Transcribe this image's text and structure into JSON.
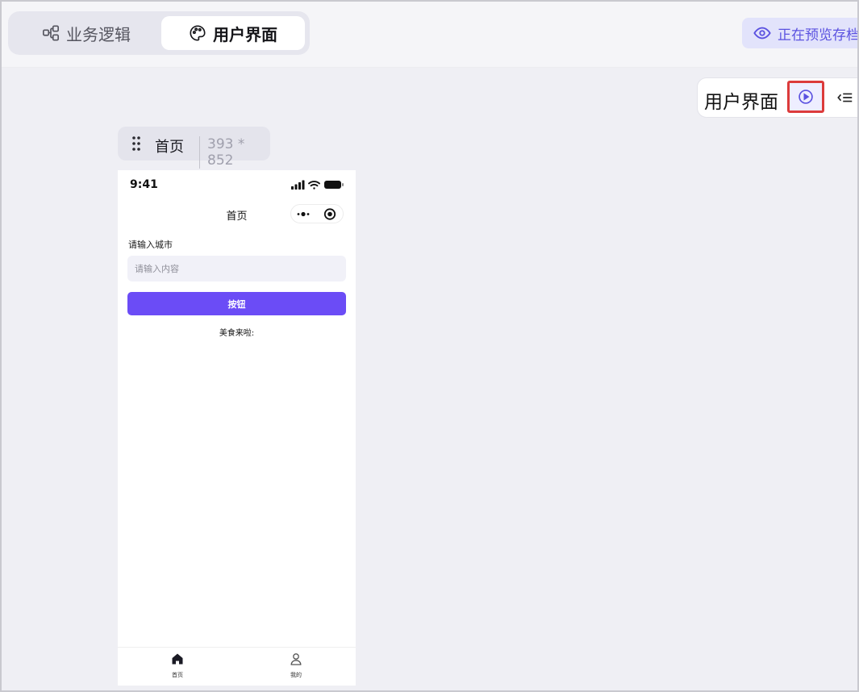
{
  "topbar": {
    "tabs": [
      {
        "label": "业务逻辑",
        "icon": "flow-nodes-icon",
        "active": false
      },
      {
        "label": "用户界面",
        "icon": "palette-icon",
        "active": true
      }
    ],
    "preview": {
      "label": "正在预览存档",
      "icon": "eye-icon"
    }
  },
  "panel": {
    "title": "用户界面",
    "run_icon": "play-circle-icon",
    "collapse_icon": "collapse-list-icon"
  },
  "page_chip": {
    "name": "首页",
    "size": "393 * 852"
  },
  "phone": {
    "status": {
      "time": "9:41"
    },
    "nav_title": "首页",
    "field_label": "请输入城市",
    "input_placeholder": "请输入内容",
    "button_label": "按钮",
    "food_text": "美食来啦:",
    "tabbar": [
      {
        "label": "首页",
        "icon": "home-icon"
      },
      {
        "label": "我的",
        "icon": "user-icon"
      }
    ]
  },
  "colors": {
    "accent": "#6b4cf6",
    "preview_text": "#5b52e0",
    "highlight_border": "#dc3b3b",
    "canvas_bg": "#efeff4"
  }
}
